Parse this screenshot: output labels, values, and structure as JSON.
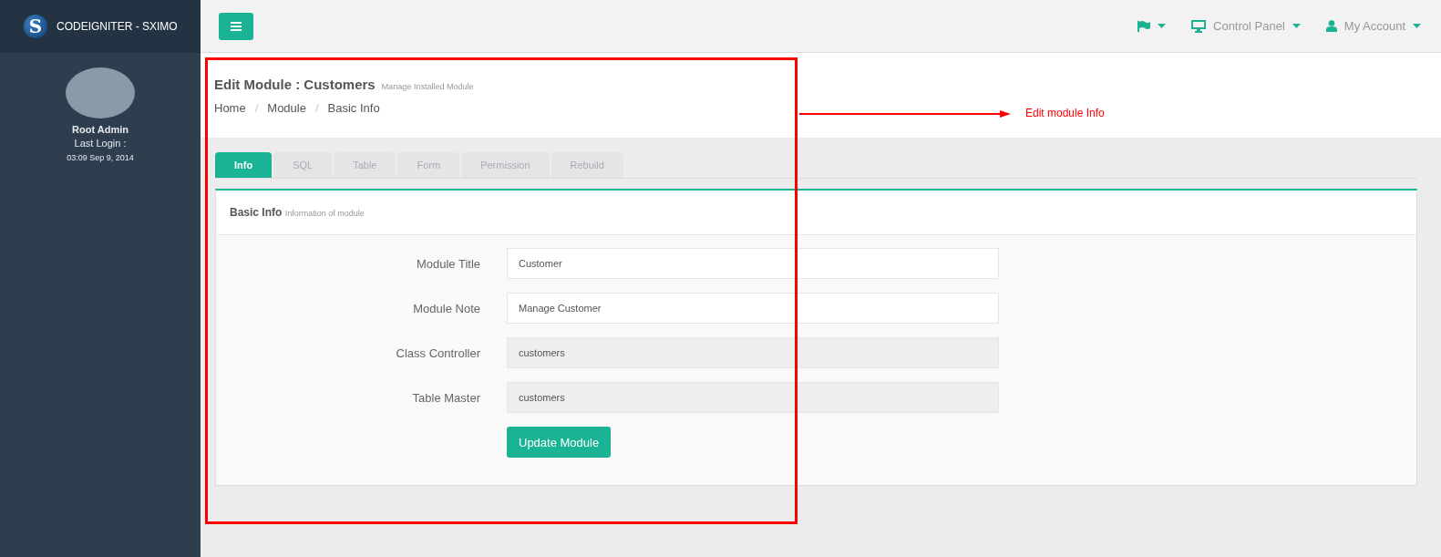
{
  "sidebar": {
    "brand": "CODEIGNITER - SXIMO",
    "logo_letter": "S",
    "user": {
      "name": "Root Admin",
      "last_login_label": "Last Login :",
      "last_login": "03:09 Sep 9, 2014"
    }
  },
  "topbar": {
    "menu_items": [
      {
        "kind": "flag"
      },
      {
        "kind": "monitor",
        "label": "Control Panel"
      },
      {
        "kind": "user",
        "label": "My Account"
      }
    ]
  },
  "page_header": {
    "title": "Edit Module : Customers",
    "subtitle": "Manage Installed Module",
    "breadcrumb": [
      "Home",
      "Module",
      "Basic Info"
    ],
    "breadcrumb_separators": [
      "/",
      "/"
    ]
  },
  "tabs": [
    {
      "label": "Info",
      "selected": true
    },
    {
      "label": "SQL",
      "selected": false
    },
    {
      "label": "Table",
      "selected": false
    },
    {
      "label": "Form",
      "selected": false
    },
    {
      "label": "Permission",
      "selected": false
    },
    {
      "label": "Rebuild",
      "selected": false
    }
  ],
  "panel": {
    "title": "Basic Info",
    "subtitle": "Information of module",
    "fields": [
      {
        "label": "Module Title",
        "value": "Customer",
        "disabled": false
      },
      {
        "label": "Module Note",
        "value": "Manage Customer",
        "disabled": false
      },
      {
        "label": "Class Controller",
        "value": "customers",
        "disabled": true
      },
      {
        "label": "Table Master",
        "value": "customers",
        "disabled": true
      }
    ],
    "submit": "Update Module"
  },
  "annotation": {
    "text": "Edit module Info"
  }
}
